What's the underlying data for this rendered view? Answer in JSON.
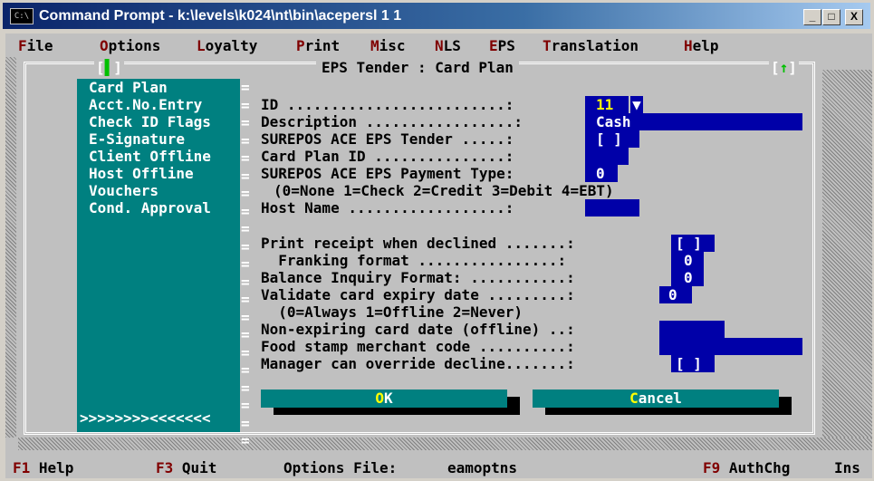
{
  "window": {
    "title": "Command Prompt - k:\\levels\\k024\\nt\\bin\\acepersl 1 1",
    "icon_text": "C:\\",
    "controls": {
      "minimize": "_",
      "maximize": "□",
      "close": "X"
    }
  },
  "menu": [
    {
      "hotkey": "F",
      "rest": "ile"
    },
    {
      "hotkey": "O",
      "rest": "ptions"
    },
    {
      "hotkey": "L",
      "rest": "oyalty"
    },
    {
      "hotkey": "P",
      "rest": "rint"
    },
    {
      "hotkey": "M",
      "rest": "isc"
    },
    {
      "hotkey": "N",
      "rest": "LS"
    },
    {
      "hotkey": "E",
      "rest": "PS"
    },
    {
      "hotkey": "T",
      "rest": "ranslation"
    },
    {
      "hotkey": "H",
      "rest": "elp"
    }
  ],
  "dialog": {
    "title": "EPS Tender : Card Plan",
    "left_marker": "▌",
    "right_marker": "↑"
  },
  "nav": {
    "items": [
      "Card Plan",
      "Acct.No.Entry",
      "Check ID Flags",
      "E-Signature",
      "Client Offline",
      "Host Offline",
      "Vouchers",
      "Cond. Approval"
    ],
    "arrows": ">>>>>>>><<<<<<<"
  },
  "fields": {
    "id_label": "ID .........................:",
    "id_value": "11",
    "id_dropdown": "▼",
    "desc_label": "Description .................:",
    "desc_value": "Cash",
    "tender_label": "SUREPOS ACE EPS Tender .....:",
    "tender_value": "[ ]",
    "cardplan_label": "Card Plan ID ...............:",
    "paytype_label": "SUREPOS ACE EPS Payment Type:",
    "paytype_value": "0",
    "paytype_hint": "(0=None 1=Check 2=Credit 3=Debit 4=EBT)",
    "hostname_label": "Host Name ..................:",
    "receipt_label": "Print receipt when declined .......:",
    "receipt_value": "[ ]",
    "franking_label": "  Franking format ................:",
    "franking_value": "0",
    "balance_label": "Balance Inquiry Format: ...........:",
    "balance_value": "0",
    "validate_label": "Validate card expiry date .........:",
    "validate_value": "0",
    "validate_hint": "  (0=Always 1=Offline 2=Never)",
    "nonexp_label": "Non-expiring card date (offline) ..:",
    "foodstamp_label": "Food stamp merchant code ..........:",
    "manager_label": "Manager can override decline.......:",
    "manager_value": "[ ]"
  },
  "buttons": {
    "ok_hk": "O",
    "ok_rest": "K",
    "cancel_hk": "C",
    "cancel_rest": "ancel"
  },
  "status": {
    "f1_key": "F1",
    "f1_label": "Help",
    "f3_key": "F3",
    "f3_label": "Quit",
    "options_label": "Options File:",
    "options_value": "eamoptns",
    "f9_key": "F9",
    "f9_label": "AuthChg",
    "mode": "Ins"
  },
  "colors": {
    "console_bg": "#c0c0c0",
    "panel_teal": "#008080",
    "field_blue": "#0000a8",
    "hotkey_red": "#800000"
  }
}
